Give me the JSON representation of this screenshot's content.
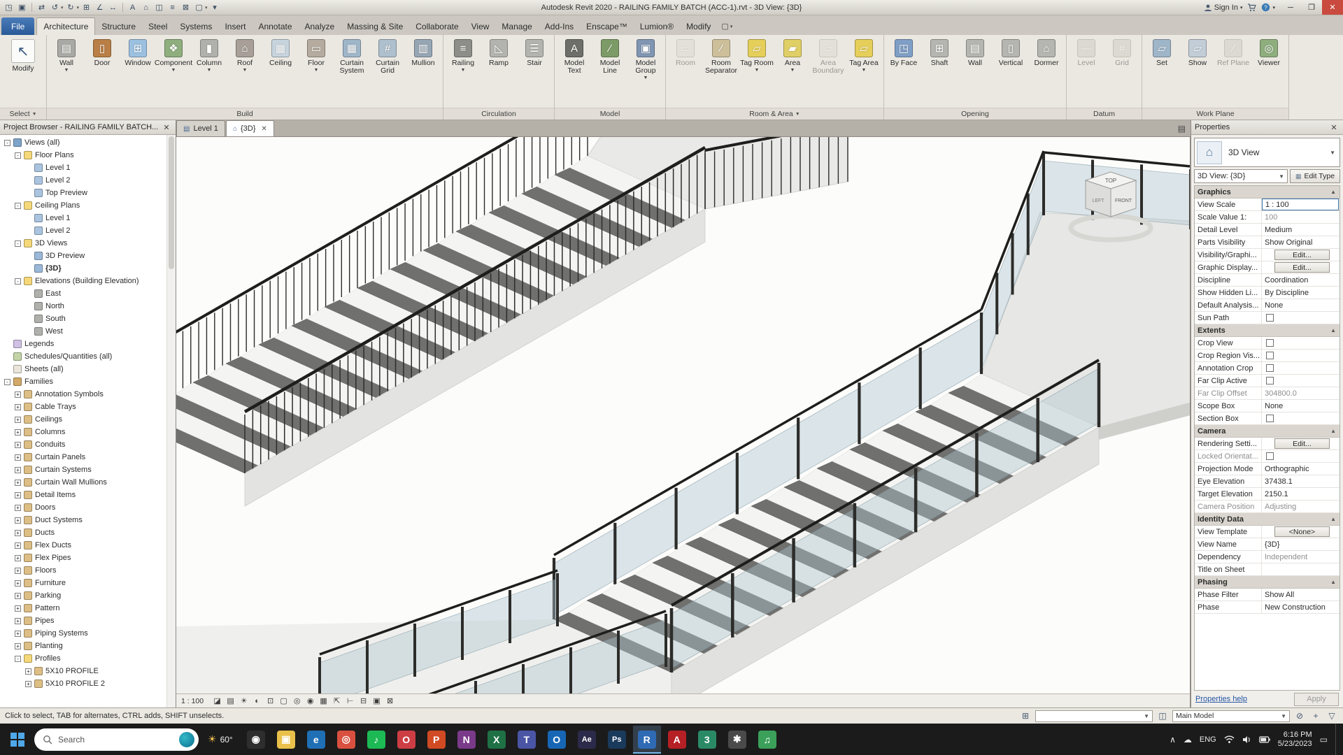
{
  "window": {
    "title": "Autodesk Revit 2020 - RAILING FAMILY BATCH (ACC-1).rvt - 3D View: {3D}",
    "sign_in": "Sign In"
  },
  "qat": [
    {
      "name": "open-file-icon",
      "glyph": "◳"
    },
    {
      "name": "save-icon",
      "glyph": "▣"
    },
    {
      "name": "sync-with-central-icon",
      "glyph": "⇄"
    },
    {
      "name": "undo-icon",
      "glyph": "↺",
      "arrow": true
    },
    {
      "name": "redo-icon",
      "glyph": "↻",
      "arrow": true
    },
    {
      "name": "print-icon",
      "glyph": "⊞"
    },
    {
      "name": "measure-icon",
      "glyph": "∠"
    },
    {
      "name": "aligned-dimension-icon",
      "glyph": "↔"
    },
    {
      "name": "text-icon",
      "glyph": "A"
    },
    {
      "name": "default-3d-view-icon",
      "glyph": "⌂"
    },
    {
      "name": "section-icon",
      "glyph": "◫"
    },
    {
      "name": "thin-lines-icon",
      "glyph": "≡"
    },
    {
      "name": "close-hidden-windows-icon",
      "glyph": "⊠"
    },
    {
      "name": "switch-windows-icon",
      "glyph": "▢",
      "arrow": true
    },
    {
      "name": "customize-qat-icon",
      "glyph": "▾"
    }
  ],
  "ribbon": {
    "tabs": [
      {
        "label": "File",
        "file": true
      },
      {
        "label": "Architecture",
        "active": true
      },
      {
        "label": "Structure"
      },
      {
        "label": "Steel"
      },
      {
        "label": "Systems"
      },
      {
        "label": "Insert"
      },
      {
        "label": "Annotate"
      },
      {
        "label": "Analyze"
      },
      {
        "label": "Massing & Site"
      },
      {
        "label": "Collaborate"
      },
      {
        "label": "View"
      },
      {
        "label": "Manage"
      },
      {
        "label": "Add-Ins"
      },
      {
        "label": "Enscape™"
      },
      {
        "label": "Lumion®"
      },
      {
        "label": "Modify"
      }
    ],
    "panels": [
      {
        "label": "Select",
        "arrow": true,
        "tools": [
          {
            "l": "Modify",
            "n": "modify-tool",
            "c": "#fbfbf9",
            "g": "↖",
            "big": true
          }
        ]
      },
      {
        "label": "Build",
        "tools": [
          {
            "l": "Wall",
            "n": "wall-tool",
            "c": "#a9a9a5",
            "g": "▤",
            "a": true
          },
          {
            "l": "Door",
            "n": "door-tool",
            "c": "#b97f46",
            "g": "▯"
          },
          {
            "l": "Window",
            "n": "window-tool",
            "c": "#9cc1e0",
            "g": "⊞"
          },
          {
            "l": "Component",
            "n": "component-tool",
            "c": "#8fae7e",
            "g": "❖",
            "a": true
          },
          {
            "l": "Column",
            "n": "column-tool",
            "c": "#b0b0ac",
            "g": "▮",
            "a": true
          },
          {
            "l": "Roof",
            "n": "roof-tool",
            "c": "#a89f98",
            "g": "⌂",
            "a": true
          },
          {
            "l": "Ceiling",
            "n": "ceiling-tool",
            "c": "#c7d4de",
            "g": "▦"
          },
          {
            "l": "Floor",
            "n": "floor-tool",
            "c": "#b5ab9e",
            "g": "▭",
            "a": true
          },
          {
            "l": "Curtain System",
            "n": "curtain-system-tool",
            "c": "#9fb6c9",
            "g": "▦"
          },
          {
            "l": "Curtain Grid",
            "n": "curtain-grid-tool",
            "c": "#aebfcd",
            "g": "#"
          },
          {
            "l": "Mullion",
            "n": "mullion-tool",
            "c": "#97a6b4",
            "g": "▥"
          }
        ]
      },
      {
        "label": "Circulation",
        "tools": [
          {
            "l": "Railing",
            "n": "railing-tool",
            "c": "#8d8d89",
            "g": "≡",
            "a": true
          },
          {
            "l": "Ramp",
            "n": "ramp-tool",
            "c": "#b3b3af",
            "g": "◺"
          },
          {
            "l": "Stair",
            "n": "stair-tool",
            "c": "#b3b3af",
            "g": "☰"
          }
        ]
      },
      {
        "label": "Model",
        "tools": [
          {
            "l": "Model Text",
            "n": "model-text-tool",
            "c": "#6e6e6a",
            "g": "A"
          },
          {
            "l": "Model Line",
            "n": "model-line-tool",
            "c": "#7d9b67",
            "g": "∕"
          },
          {
            "l": "Model Group",
            "n": "model-group-tool",
            "c": "#8096b2",
            "g": "▣",
            "a": true
          }
        ]
      },
      {
        "label": "Room & Area",
        "arrow": true,
        "tools": [
          {
            "l": "Room",
            "n": "room-tool",
            "c": "#d9d6cf",
            "g": "▭",
            "dis": true
          },
          {
            "l": "Room Separator",
            "n": "room-separator-tool",
            "c": "#cdbf9a",
            "g": "∕"
          },
          {
            "l": "Tag Room",
            "n": "tag-room-tool",
            "c": "#e5cf5a",
            "g": "▱",
            "a": true
          },
          {
            "l": "Area",
            "n": "area-tool",
            "c": "#e0cf66",
            "g": "▰",
            "a": true
          },
          {
            "l": "Area Boundary",
            "n": "area-boundary-tool",
            "c": "#d9d6cf",
            "g": "▱",
            "dis": true
          },
          {
            "l": "Tag Area",
            "n": "tag-area-tool",
            "c": "#e5cf5a",
            "g": "▱",
            "a": true
          }
        ]
      },
      {
        "label": "Opening",
        "tools": [
          {
            "l": "By Face",
            "n": "opening-by-face-tool",
            "c": "#7f9fc6",
            "g": "◳"
          },
          {
            "l": "Shaft",
            "n": "shaft-opening-tool",
            "c": "#b5b5b1",
            "g": "⊞"
          },
          {
            "l": "Wall",
            "n": "wall-opening-tool",
            "c": "#b5b5b1",
            "g": "▤"
          },
          {
            "l": "Vertical",
            "n": "vertical-opening-tool",
            "c": "#b5b5b1",
            "g": "▯"
          },
          {
            "l": "Dormer",
            "n": "dormer-opening-tool",
            "c": "#b5b5b1",
            "g": "⌂"
          }
        ]
      },
      {
        "label": "Datum",
        "tools": [
          {
            "l": "Level",
            "n": "level-tool",
            "c": "#c9c6bf",
            "g": "—",
            "dis": true
          },
          {
            "l": "Grid",
            "n": "grid-tool",
            "c": "#c9c6bf",
            "g": "#",
            "dis": true
          }
        ]
      },
      {
        "label": "Work Plane",
        "tools": [
          {
            "l": "Set",
            "n": "set-work-plane-tool",
            "c": "#9fb6c9",
            "g": "▱"
          },
          {
            "l": "Show",
            "n": "show-work-plane-tool",
            "c": "#c2cdd8",
            "g": "▱"
          },
          {
            "l": "Ref Plane",
            "n": "ref-plane-tool",
            "c": "#c9c6bf",
            "g": "∕",
            "dis": true
          },
          {
            "l": "Viewer",
            "n": "viewer-tool",
            "c": "#8fae7e",
            "g": "◎"
          }
        ]
      }
    ]
  },
  "view_tabs": [
    {
      "label": "Level 1",
      "icon": "plan",
      "active": false,
      "closable": false
    },
    {
      "label": "{3D}",
      "icon": "3d",
      "active": true,
      "closable": true
    }
  ],
  "project_browser": {
    "title": "Project Browser - RAILING FAMILY BATCH...",
    "items": [
      {
        "d": 0,
        "e": "-",
        "i": "views",
        "l": "Views (all)"
      },
      {
        "d": 1,
        "e": "-",
        "i": "folder",
        "l": "Floor Plans"
      },
      {
        "d": 2,
        "i": "plan",
        "l": "Level 1"
      },
      {
        "d": 2,
        "i": "plan",
        "l": "Level 2"
      },
      {
        "d": 2,
        "i": "plan",
        "l": "Top Preview"
      },
      {
        "d": 1,
        "e": "-",
        "i": "folder",
        "l": "Ceiling Plans"
      },
      {
        "d": 2,
        "i": "plan",
        "l": "Level 1"
      },
      {
        "d": 2,
        "i": "plan",
        "l": "Level 2"
      },
      {
        "d": 1,
        "e": "-",
        "i": "folder",
        "l": "3D Views"
      },
      {
        "d": 2,
        "i": "view3d",
        "l": "3D Preview"
      },
      {
        "d": 2,
        "i": "view3d",
        "l": "{3D}",
        "bold": true
      },
      {
        "d": 1,
        "e": "-",
        "i": "folder",
        "l": "Elevations (Building Elevation)"
      },
      {
        "d": 2,
        "i": "elev",
        "l": "East"
      },
      {
        "d": 2,
        "i": "elev",
        "l": "North"
      },
      {
        "d": 2,
        "i": "elev",
        "l": "South"
      },
      {
        "d": 2,
        "i": "elev",
        "l": "West"
      },
      {
        "d": 0,
        "i": "legend",
        "l": "Legends"
      },
      {
        "d": 0,
        "i": "schedule",
        "l": "Schedules/Quantities (all)"
      },
      {
        "d": 0,
        "i": "sheet",
        "l": "Sheets (all)"
      },
      {
        "d": 0,
        "e": "-",
        "i": "families",
        "l": "Families"
      },
      {
        "d": 1,
        "e": "+",
        "i": "cat",
        "l": "Annotation Symbols"
      },
      {
        "d": 1,
        "e": "+",
        "i": "cat",
        "l": "Cable Trays"
      },
      {
        "d": 1,
        "e": "+",
        "i": "cat",
        "l": "Ceilings"
      },
      {
        "d": 1,
        "e": "+",
        "i": "cat",
        "l": "Columns"
      },
      {
        "d": 1,
        "e": "+",
        "i": "cat",
        "l": "Conduits"
      },
      {
        "d": 1,
        "e": "+",
        "i": "cat",
        "l": "Curtain Panels"
      },
      {
        "d": 1,
        "e": "+",
        "i": "cat",
        "l": "Curtain Systems"
      },
      {
        "d": 1,
        "e": "+",
        "i": "cat",
        "l": "Curtain Wall Mullions"
      },
      {
        "d": 1,
        "e": "+",
        "i": "cat",
        "l": "Detail Items"
      },
      {
        "d": 1,
        "e": "+",
        "i": "cat",
        "l": "Doors"
      },
      {
        "d": 1,
        "e": "+",
        "i": "cat",
        "l": "Duct Systems"
      },
      {
        "d": 1,
        "e": "+",
        "i": "cat",
        "l": "Ducts"
      },
      {
        "d": 1,
        "e": "+",
        "i": "cat",
        "l": "Flex Ducts"
      },
      {
        "d": 1,
        "e": "+",
        "i": "cat",
        "l": "Flex Pipes"
      },
      {
        "d": 1,
        "e": "+",
        "i": "cat",
        "l": "Floors"
      },
      {
        "d": 1,
        "e": "+",
        "i": "cat",
        "l": "Furniture"
      },
      {
        "d": 1,
        "e": "+",
        "i": "cat",
        "l": "Parking"
      },
      {
        "d": 1,
        "e": "+",
        "i": "cat",
        "l": "Pattern"
      },
      {
        "d": 1,
        "e": "+",
        "i": "cat",
        "l": "Pipes"
      },
      {
        "d": 1,
        "e": "+",
        "i": "cat",
        "l": "Piping Systems"
      },
      {
        "d": 1,
        "e": "+",
        "i": "cat",
        "l": "Planting"
      },
      {
        "d": 1,
        "e": "-",
        "i": "folder",
        "l": "Profiles"
      },
      {
        "d": 2,
        "e": "+",
        "i": "profile",
        "l": "5X10 PROFILE"
      },
      {
        "d": 2,
        "e": "+",
        "i": "profile",
        "l": "5X10 PROFILE 2"
      }
    ]
  },
  "properties": {
    "header": "Properties",
    "type_label": "3D View",
    "type_combo": "3D View: {3D}",
    "edit_type": "Edit Type",
    "rows": [
      {
        "t": "group",
        "label": "Graphics"
      },
      {
        "t": "row",
        "label": "View Scale",
        "value": "1 : 100",
        "focus": true
      },
      {
        "t": "row",
        "label": "Scale Value   1:",
        "value": "100",
        "vgray": true
      },
      {
        "t": "row",
        "label": "Detail Level",
        "value": "Medium"
      },
      {
        "t": "row",
        "label": "Parts Visibility",
        "value": "Show Original"
      },
      {
        "t": "btn",
        "label": "Visibility/Graphi...",
        "value": "Edit..."
      },
      {
        "t": "btn",
        "label": "Graphic Display...",
        "value": "Edit..."
      },
      {
        "t": "row",
        "label": "Discipline",
        "value": "Coordination"
      },
      {
        "t": "row",
        "label": "Show Hidden Li...",
        "value": "By Discipline"
      },
      {
        "t": "row",
        "label": "Default Analysis...",
        "value": "None"
      },
      {
        "t": "check",
        "label": "Sun Path"
      },
      {
        "t": "group",
        "label": "Extents"
      },
      {
        "t": "check",
        "label": "Crop View"
      },
      {
        "t": "check",
        "label": "Crop Region Vis..."
      },
      {
        "t": "check",
        "label": "Annotation Crop"
      },
      {
        "t": "check",
        "label": "Far Clip Active"
      },
      {
        "t": "row",
        "label": "Far Clip Offset",
        "value": "304800.0",
        "lgray": true,
        "vgray": true
      },
      {
        "t": "row",
        "label": "Scope Box",
        "value": "None"
      },
      {
        "t": "check",
        "label": "Section Box"
      },
      {
        "t": "group",
        "label": "Camera"
      },
      {
        "t": "btn",
        "label": "Rendering Setti...",
        "value": "Edit..."
      },
      {
        "t": "check",
        "label": "Locked Orientat...",
        "lgray": true
      },
      {
        "t": "row",
        "label": "Projection Mode",
        "value": "Orthographic"
      },
      {
        "t": "row",
        "label": "Eye Elevation",
        "value": "37438.1"
      },
      {
        "t": "row",
        "label": "Target Elevation",
        "value": "2150.1"
      },
      {
        "t": "row",
        "label": "Camera Position",
        "value": "Adjusting",
        "lgray": true,
        "vgray": true
      },
      {
        "t": "group",
        "label": "Identity Data"
      },
      {
        "t": "btn",
        "label": "View Template",
        "value": "<None>"
      },
      {
        "t": "row",
        "label": "View Name",
        "value": "{3D}"
      },
      {
        "t": "row",
        "label": "Dependency",
        "value": "Independent",
        "vgray": true
      },
      {
        "t": "row",
        "label": "Title on Sheet",
        "value": ""
      },
      {
        "t": "group",
        "label": "Phasing"
      },
      {
        "t": "row",
        "label": "Phase Filter",
        "value": "Show All"
      },
      {
        "t": "row",
        "label": "Phase",
        "value": "New Construction"
      }
    ],
    "help_link": "Properties help",
    "apply_label": "Apply"
  },
  "canvas": {
    "viewcube": {
      "top": "TOP",
      "front": "FRONT",
      "left": "LEFT"
    }
  },
  "view_control_bar": {
    "scale": "1 : 100",
    "icons": [
      {
        "name": "visual-style-icon",
        "glyph": "◪"
      },
      {
        "name": "detail-level-icon",
        "glyph": "▤"
      },
      {
        "name": "sun-path-icon",
        "glyph": "☀"
      },
      {
        "name": "shadows-icon",
        "glyph": "◐"
      },
      {
        "name": "crop-view-icon",
        "glyph": "⊡"
      },
      {
        "name": "show-crop-region-icon",
        "glyph": "▢"
      },
      {
        "name": "temporary-hide-isolate-icon",
        "glyph": "◎"
      },
      {
        "name": "reveal-hidden-elements-icon",
        "glyph": "◉"
      },
      {
        "name": "temporary-view-properties-icon",
        "glyph": "▦"
      },
      {
        "name": "displacement-icon",
        "glyph": "⇱"
      },
      {
        "name": "reveal-constraints-icon",
        "glyph": "⊢"
      },
      {
        "name": "worksharing-display-icon",
        "glyph": "⊟"
      },
      {
        "name": "section-box-icon",
        "glyph": "▣"
      },
      {
        "name": "lock-view-icon",
        "glyph": "⊠"
      }
    ]
  },
  "status_bar": {
    "message": "Click to select, TAB for alternates, CTRL adds, SHIFT unselects.",
    "workset_value": "",
    "design_option_value": "Main Model",
    "right_icons": [
      {
        "name": "worksets-icon",
        "glyph": "⊞"
      },
      {
        "name": "design-options-icon",
        "glyph": "◫"
      }
    ],
    "far_icons": [
      {
        "name": "exclude-options-icon",
        "glyph": "⊘"
      },
      {
        "name": "press-drag-icon",
        "glyph": "+"
      },
      {
        "name": "filter-icon",
        "glyph": "▽"
      }
    ]
  },
  "taskbar": {
    "search_placeholder": "Search",
    "weather": "60°",
    "apps": [
      {
        "name": "camera-app",
        "c": "#2e2e2e",
        "g": "◉"
      },
      {
        "name": "file-explorer",
        "c": "#e9c04a",
        "g": "▣"
      },
      {
        "name": "edge-browser",
        "c": "#1f6fb5",
        "g": "e"
      },
      {
        "name": "chrome-browser",
        "c": "#d95040",
        "g": "◎"
      },
      {
        "name": "spotify",
        "c": "#1db954",
        "g": "♪"
      },
      {
        "name": "opera-browser",
        "c": "#cc3e44",
        "g": "O"
      },
      {
        "name": "powerpoint",
        "c": "#d04a23",
        "g": "P"
      },
      {
        "name": "onenote",
        "c": "#7a3a8a",
        "g": "N"
      },
      {
        "name": "excel",
        "c": "#1f7145",
        "g": "X"
      },
      {
        "name": "teams",
        "c": "#4a55a5",
        "g": "T"
      },
      {
        "name": "outlook",
        "c": "#1766b5",
        "g": "O"
      },
      {
        "name": "after-effects",
        "c": "#2b2a4a",
        "g": "Ae"
      },
      {
        "name": "photoshop",
        "c": "#1a3a5c",
        "g": "Ps"
      },
      {
        "name": "revit",
        "c": "#2f6bb5",
        "g": "R",
        "active": true
      },
      {
        "name": "acrobat",
        "c": "#b52025",
        "g": "A"
      },
      {
        "name": "3ds-max",
        "c": "#2a8a66",
        "g": "3"
      },
      {
        "name": "settings",
        "c": "#4a4a4a",
        "g": "✱"
      },
      {
        "name": "music-app",
        "c": "#3aa05a",
        "g": "♫"
      }
    ],
    "tray": {
      "language": "ENG",
      "time": "6:16 PM",
      "date": "5/23/2023"
    }
  }
}
